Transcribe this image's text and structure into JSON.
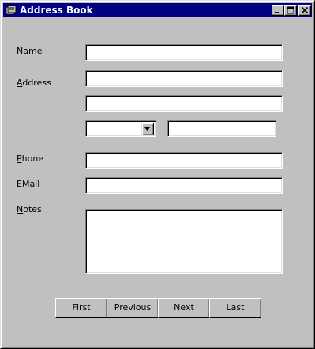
{
  "window": {
    "title": "Address Book"
  },
  "title_buttons": {
    "minimize": "minimize",
    "maximize": "maximize",
    "close": "close"
  },
  "labels": {
    "name": {
      "accel": "N",
      "rest": "ame"
    },
    "address": {
      "accel": "A",
      "rest": "ddress"
    },
    "phone": {
      "accel": "P",
      "rest": "hone"
    },
    "email": {
      "accel": "E",
      "rest": "Mail"
    },
    "notes": {
      "accel": "N",
      "rest": "otes"
    }
  },
  "fields": {
    "name": "",
    "address_line1": "",
    "address_line2": "",
    "state": "",
    "zip": "",
    "phone": "",
    "email": "",
    "notes": ""
  },
  "nav": {
    "first": "First",
    "previous": "Previous",
    "next": "Next",
    "last": "Last"
  },
  "icons": {
    "app": "address-book-icon",
    "dropdown": "chevron-down-icon"
  }
}
